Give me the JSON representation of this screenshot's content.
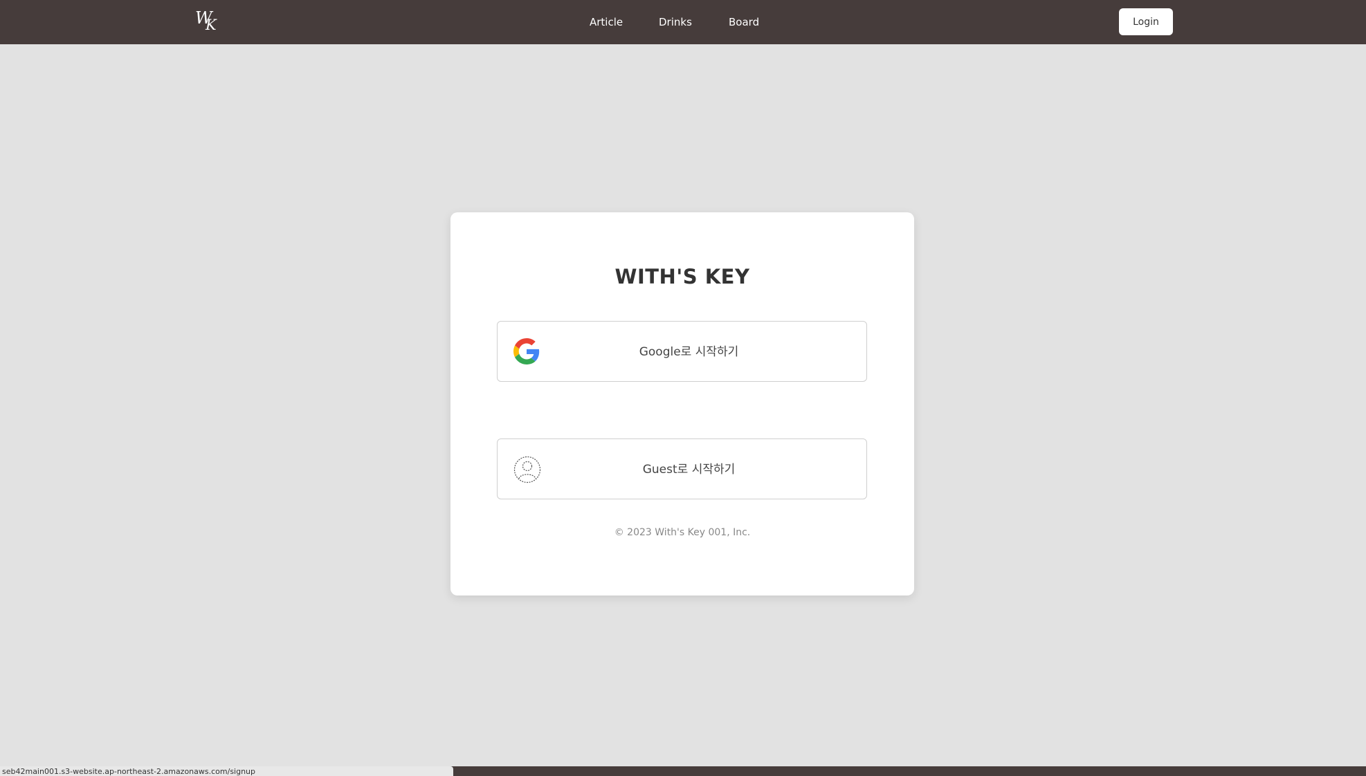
{
  "header": {
    "logo_text": "WK",
    "nav": [
      {
        "label": "Article"
      },
      {
        "label": "Drinks"
      },
      {
        "label": "Board"
      }
    ],
    "login_label": "Login"
  },
  "card": {
    "title": "WITH'S KEY",
    "google_label": "Google로 시작하기",
    "google_icon": "google-icon",
    "guest_label": "Guest로 시작하기",
    "guest_icon": "user-icon",
    "copyright": "© 2023 With's Key 001, Inc."
  },
  "status_bar": {
    "url": "seb42main001.s3-website.ap-northeast-2.amazonaws.com/signup"
  },
  "colors": {
    "nav_bg": "#463c3b",
    "page_bg": "#e2e2e2",
    "card_bg": "#ffffff"
  }
}
